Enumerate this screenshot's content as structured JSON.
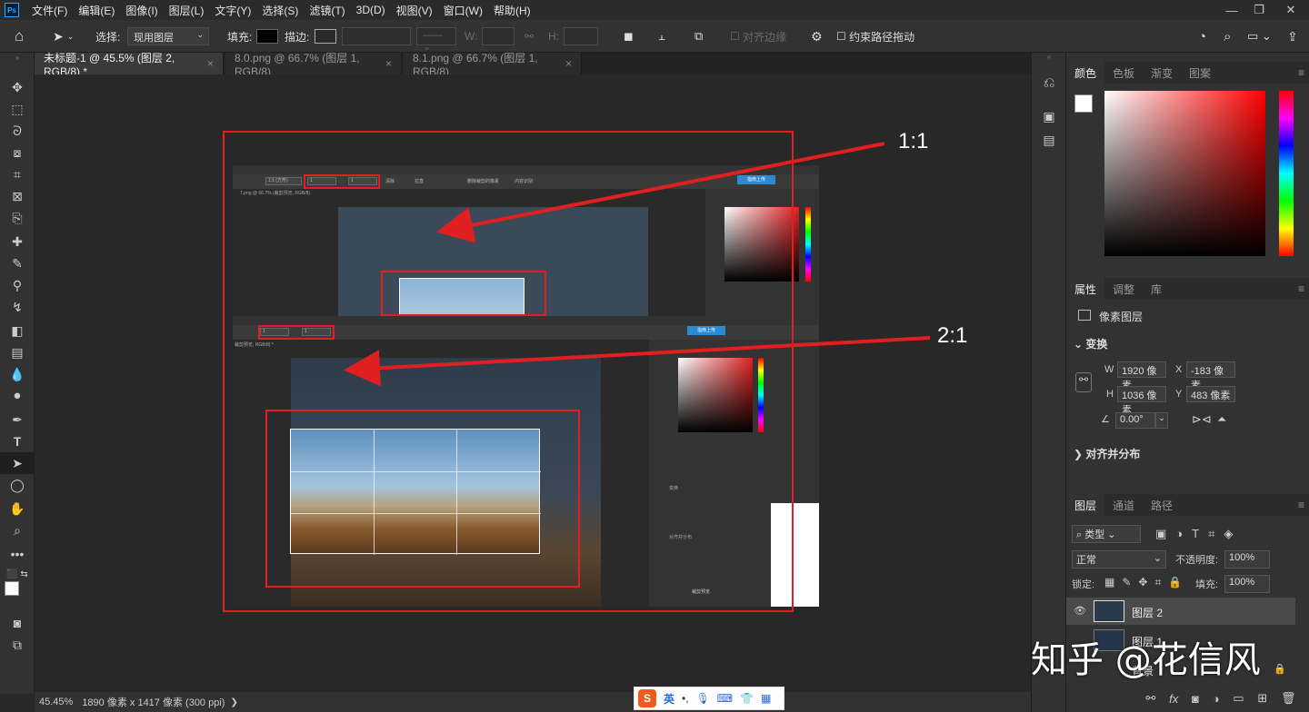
{
  "menubar": {
    "app_icon": "Ps",
    "items": [
      "文件(F)",
      "编辑(E)",
      "图像(I)",
      "图层(L)",
      "文字(Y)",
      "选择(S)",
      "滤镜(T)",
      "3D(D)",
      "视图(V)",
      "窗口(W)",
      "帮助(H)"
    ],
    "window_controls": [
      "—",
      "❐",
      "✕"
    ]
  },
  "options_bar": {
    "select_label": "选择:",
    "select_value": "现用图层",
    "fill_label": "填充:",
    "stroke_label": "描边:",
    "w_label": "W:",
    "h_label": "H:",
    "align_edges": "对齐边缘",
    "constrain_path": "约束路径拖动"
  },
  "tabs": [
    {
      "label": "未标题-1 @ 45.5% (图层 2, RGB/8) *",
      "close": "×"
    },
    {
      "label": "8.0.png @ 66.7% (图层 1, RGB/8)",
      "close": "×"
    },
    {
      "label": "8.1.png @ 66.7% (图层 1, RGB/8)",
      "close": "×"
    }
  ],
  "annotations": {
    "ratio_1": "1:1",
    "ratio_2": "2:1"
  },
  "inner_mock": {
    "tab_label": "7.png @ 66.7% (裁剪预览, RGB/8)",
    "upload_button": "指南上传",
    "upload_button_2": "指南上传",
    "ratio_field": "1:1 (方形)",
    "ratio_value_1": "1",
    "ratio_value_2": "1",
    "clear_label": "清除",
    "straighten_label": "拉直",
    "delete_cropped": "删除裁剪的像素",
    "content_aware": "内容识别",
    "tab_label_2": "裁剪预览, RGB/8) *",
    "ratio_value_3": "1",
    "ratio_value_4": "1",
    "align_label": "对齐并分布",
    "transform_label": "变换",
    "layer_name": "裁剪预览"
  },
  "status": {
    "zoom": "45.45%",
    "doc_info": "1890 像素 x 1417 像素 (300 ppi)",
    "arrow": "❯"
  },
  "color_panel": {
    "tabs": [
      "颜色",
      "色板",
      "渐变",
      "图案"
    ]
  },
  "properties_panel": {
    "tabs": [
      "属性",
      "调整",
      "库"
    ],
    "layer_type": "像素图层",
    "transform_title": "变换",
    "w_label": "W",
    "w_value": "1920 像素",
    "x_label": "X",
    "x_value": "-183 像素",
    "h_label": "H",
    "h_value": "1036 像素",
    "y_label": "Y",
    "y_value": "483 像素",
    "angle_value": "0.00°",
    "align_title": "对齐并分布"
  },
  "layers_panel": {
    "tabs": [
      "图层",
      "通道",
      "路径"
    ],
    "filter_label": "类型",
    "blend_mode": "正常",
    "opacity_label": "不透明度:",
    "opacity_value": "100%",
    "lock_label": "锁定:",
    "fill_label": "填充:",
    "fill_value": "100%",
    "layers": [
      {
        "name": "图层 2"
      },
      {
        "name": "图层 1"
      },
      {
        "name": "背景"
      }
    ]
  },
  "watermark": "知乎 @花信风",
  "ime_bar": {
    "logo": "S",
    "lang": "英"
  },
  "colors": {
    "accent": "#31a8ff",
    "annotation_red": "#e02020"
  }
}
